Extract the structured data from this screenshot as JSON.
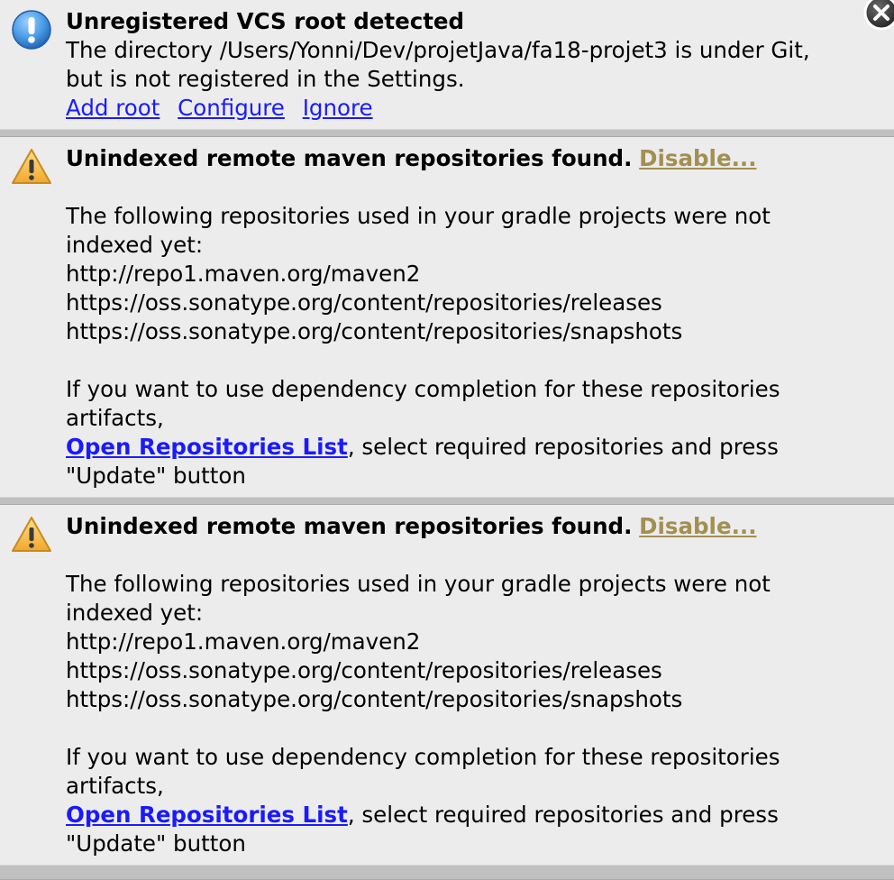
{
  "vcs_notification": {
    "title": "Unregistered VCS root detected",
    "message_line1": "The directory /Users/Yonni/Dev/projetJava/fa18-projet3 is under Git,",
    "message_line2": "but is not registered in the Settings.",
    "links": [
      "Add root",
      "Configure",
      "Ignore"
    ],
    "icon": "info-icon"
  },
  "maven_notifications": [
    {
      "title": "Unindexed remote maven repositories found.",
      "disable_label": "Disable...",
      "intro_line1": "The following repositories used in your gradle projects were not",
      "intro_line2": "indexed yet:",
      "repositories": [
        "http://repo1.maven.org/maven2",
        "https://oss.sonatype.org/content/repositories/releases",
        "https://oss.sonatype.org/content/repositories/snapshots"
      ],
      "hint_line1": "If you want to use dependency completion for these repositories",
      "hint_line2": "artifacts,",
      "open_link": "Open Repositories List",
      "after_link": ", select required repositories and press",
      "final_line": "\"Update\" button",
      "icon": "warning-icon"
    },
    {
      "title": "Unindexed remote maven repositories found.",
      "disable_label": "Disable...",
      "intro_line1": "The following repositories used in your gradle projects were not",
      "intro_line2": "indexed yet:",
      "repositories": [
        "http://repo1.maven.org/maven2",
        "https://oss.sonatype.org/content/repositories/releases",
        "https://oss.sonatype.org/content/repositories/snapshots"
      ],
      "hint_line1": "If you want to use dependency completion for these repositories",
      "hint_line2": "artifacts,",
      "open_link": "Open Repositories List",
      "after_link": ", select required repositories and press",
      "final_line": "\"Update\" button",
      "icon": "warning-icon"
    }
  ],
  "close_button": {
    "icon": "close-icon"
  },
  "colors": {
    "background": "#ececec",
    "link": "#1a1aff",
    "disable_link": "#a28f52",
    "info_icon": "#3f8fd8",
    "warning_icon": "#f3b73b"
  }
}
